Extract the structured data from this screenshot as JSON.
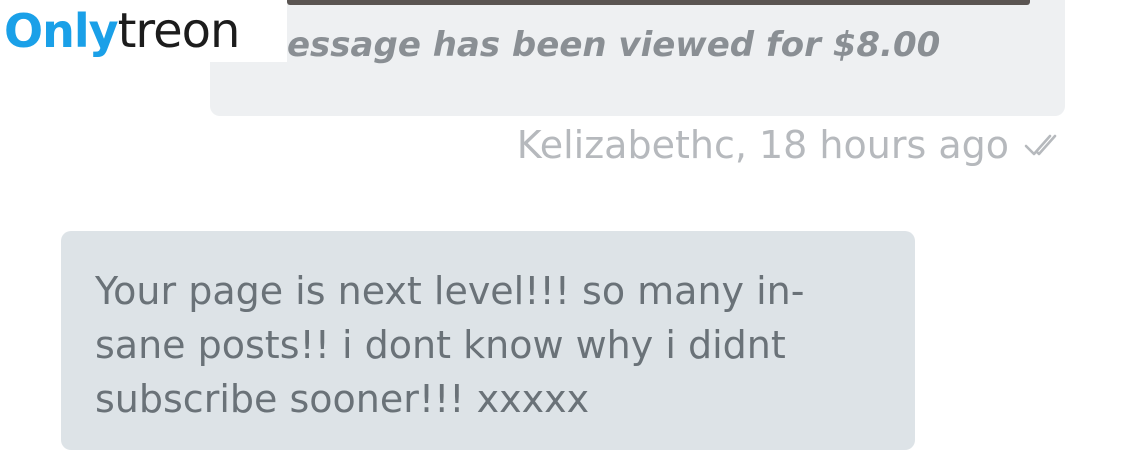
{
  "watermark": {
    "brand_part1": "Only",
    "brand_part2": "treon"
  },
  "outgoing_message": {
    "paid_note": "essage has been viewed for $8.00",
    "meta": "Kelizabethc, 18 hours ago",
    "status_icon": "double-check-icon"
  },
  "incoming_message": {
    "lines": [
      "Your page is next level!!! so many in-",
      "sane posts!! i dont know why i didnt",
      "subscribe sooner!!! xxxxx"
    ]
  },
  "colors": {
    "outgoing_bubble": "#eef0f2",
    "incoming_bubble": "#dde3e7",
    "meta_text": "#b6b9bd",
    "brand_blue": "#1aa0e8"
  }
}
